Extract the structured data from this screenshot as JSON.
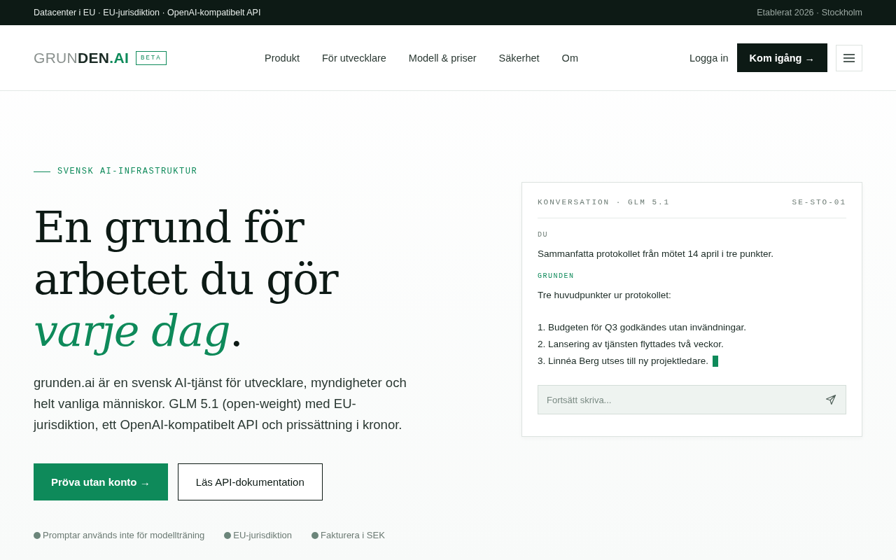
{
  "topbar": {
    "left": "Datacenter i EU · EU-jurisdiktion · OpenAI-kompatibelt API",
    "right": "Etablerat 2026 · Stockholm"
  },
  "header": {
    "logo": [
      {
        "text": "GRUN",
        "kind": "light"
      },
      {
        "text": "DEN",
        "kind": "bold"
      },
      {
        "text": ".AI",
        "kind": "accent"
      }
    ],
    "badge": "BETA",
    "nav": [
      "Produkt",
      "För utvecklare",
      "Modell & priser",
      "Säkerhet",
      "Om"
    ],
    "login": "Logga in",
    "cta": "Kom igång →"
  },
  "hero": {
    "eyebrow": "SVENSK AI-INFRASTRUKTUR",
    "headline": [
      {
        "text": "En grund för",
        "kind": "plain"
      },
      {
        "text": "arbetet du gör",
        "kind": "plain"
      },
      {
        "text": "varje dag",
        "kind": "accent",
        "suffix": "."
      }
    ],
    "lead": "grunden.ai är en svensk AI-tjänst för utvecklare, myndigheter och helt vanliga människor. GLM 5.1 (open-weight) med EU-jurisdiktion, ett OpenAI-kompatibelt API och prissättning i kronor.",
    "buttons": [
      {
        "label": "Pröva utan konto →",
        "kind": "primary"
      },
      {
        "label": "Läs API-dokumentation",
        "kind": "secondary"
      }
    ],
    "facts": [
      "Promptar används inte för modellträning",
      "EU-jurisdiktion",
      "Fakturera i SEK"
    ]
  },
  "chat": {
    "title": "KONVERSATION · GLM 5.1",
    "region": "SE-STO-01",
    "messages": [
      {
        "role": "DU",
        "kind": "user",
        "lines": [
          "Sammanfatta protokollet från mötet 14 april i tre punkter."
        ]
      },
      {
        "role": "GRUNDEN",
        "kind": "assistant",
        "lines": [
          "Tre huvudpunkter ur protokollet:"
        ],
        "points": [
          "1. Budgeten för Q3 godkändes utan invändningar.",
          "2. Lansering av tjänsten flyttades två veckor.",
          "3. Linnéa Berg utses till ny projektledare."
        ]
      }
    ],
    "placeholder": "Fortsätt skriva..."
  }
}
